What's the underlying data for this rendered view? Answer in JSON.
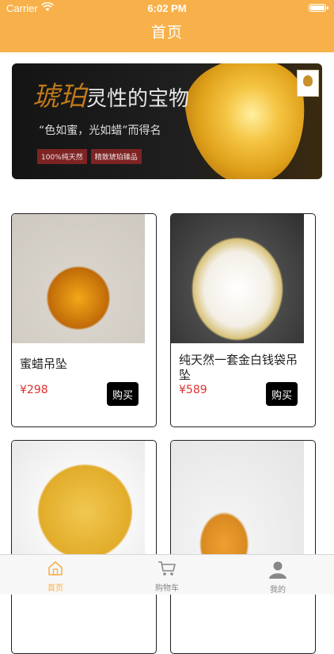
{
  "status_bar": {
    "carrier": "Carrier",
    "time": "6:02 PM"
  },
  "header": {
    "title": "首页",
    "background": "#F8B14A"
  },
  "banner": {
    "headline_accent": "琥珀",
    "headline_rest": "灵性的宝物",
    "subtitle": "“色如蜜，光如蜡”而得名",
    "tags": [
      "100%纯天然",
      "精致琥珀臻品"
    ]
  },
  "products": [
    {
      "name": "蜜蜡吊坠",
      "price": "¥298",
      "buy_label": "购买"
    },
    {
      "name": "纯天然一套金白钱袋吊坠",
      "price": "¥589",
      "buy_label": "购买"
    },
    {
      "name": "",
      "price": "",
      "buy_label": ""
    },
    {
      "name": "",
      "price": "",
      "buy_label": ""
    }
  ],
  "tabbar": {
    "items": [
      {
        "label": "首页",
        "icon": "home-icon",
        "active": true
      },
      {
        "label": "购物车",
        "icon": "cart-icon",
        "active": false
      },
      {
        "label": "我的",
        "icon": "user-icon",
        "active": false
      }
    ],
    "active_color": "#F8B14A"
  }
}
